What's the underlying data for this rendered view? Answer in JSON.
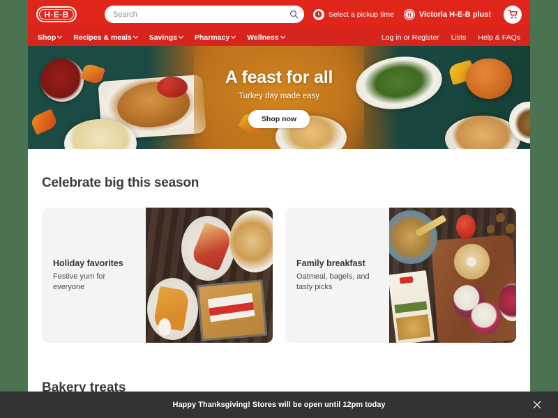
{
  "header": {
    "logo_text": "H·E·B",
    "search": {
      "placeholder": "Search",
      "value": "",
      "button_icon": "search-icon"
    },
    "pickup": {
      "label": "Select a pickup time",
      "icon": "clock-icon"
    },
    "store": {
      "label": "Victoria H-E-B plus!",
      "icon": "heb-circle-icon"
    },
    "cart": {
      "icon": "cart-icon"
    }
  },
  "nav": {
    "left_items": [
      {
        "label": "Shop",
        "has_chevron": true
      },
      {
        "label": "Recipes & meals",
        "has_chevron": true
      },
      {
        "label": "Savings",
        "has_chevron": true
      },
      {
        "label": "Pharmacy",
        "has_chevron": true
      },
      {
        "label": "Wellness",
        "has_chevron": true
      }
    ],
    "right_items": [
      {
        "label": "Log in or Register"
      },
      {
        "label": "Lists"
      },
      {
        "label": "Help & FAQs"
      }
    ]
  },
  "hero": {
    "title": "A feast for all",
    "subtitle": "Turkey day made easy",
    "cta_label": "Shop now"
  },
  "main": {
    "section_title": "Celebrate big this season",
    "cards": [
      {
        "title": "Holiday favorites",
        "subtitle": "Festive yum for everyone"
      },
      {
        "title": "Family breakfast",
        "subtitle": "Oatmeal, bagels, and tasty picks"
      }
    ],
    "section_title_2": "Bakery treats"
  },
  "banner": {
    "message": "Happy Thanksgiving! Stores will be open until 12pm today",
    "close_icon": "close-icon"
  },
  "colors": {
    "brand_red": "#e0251b",
    "nav_red": "#d6251d",
    "page_bg": "#ffffff",
    "outer_bg": "#4b7352",
    "card_bg": "#f4f4f4",
    "banner_bg": "#333333",
    "hero_accent": "#c87a1c"
  }
}
